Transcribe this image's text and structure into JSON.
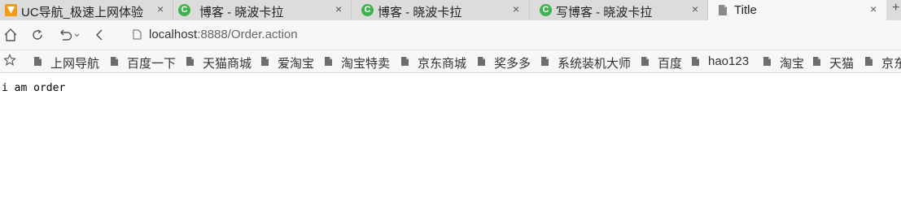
{
  "tabs": [
    {
      "title": "UC导航_极速上网体验",
      "icon": "uc-logo-icon"
    },
    {
      "title": "博客 - 晓波卡拉",
      "icon": "csdn-icon"
    },
    {
      "title": "博客 - 晓波卡拉",
      "icon": "csdn-icon"
    },
    {
      "title": "写博客 - 晓波卡拉",
      "icon": "csdn-icon"
    },
    {
      "title": "Title",
      "icon": "document-icon",
      "active": true
    }
  ],
  "tab_close_glyph": "×",
  "new_tab_glyph": "+",
  "address": {
    "host": "localhost",
    "path": ":8888/Order.action"
  },
  "bookmarks": [
    "上网导航",
    "百度一下",
    "天猫商城",
    "爱淘宝",
    "淘宝特卖",
    "京东商城",
    "奖多多",
    "系统装机大师",
    "百度",
    "hao123",
    "淘宝",
    "天猫",
    "京东"
  ],
  "csdn_letter": "C",
  "page": {
    "body_text": "i am order"
  }
}
